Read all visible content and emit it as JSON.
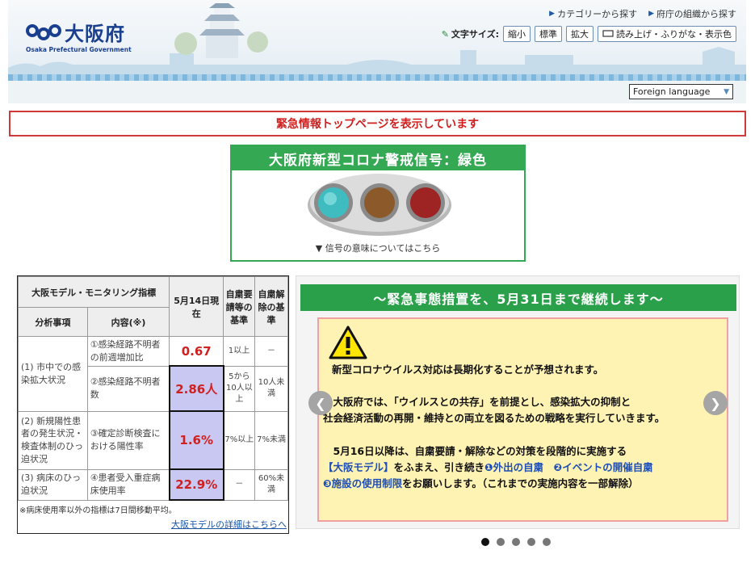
{
  "header": {
    "logo_jp": "大阪府",
    "logo_en": "Osaka Prefectural Government",
    "links": [
      "カテゴリーから探す",
      "府庁の組織から探す"
    ],
    "text_size_label": "文字サイズ:",
    "text_size_buttons": [
      "縮小",
      "標準",
      "拡大"
    ],
    "read_button": "読み上げ・ふりがな・表示色",
    "language": "Foreign language"
  },
  "emergency_banner": "緊急情報トップページを表示しています",
  "signal": {
    "title": "大阪府新型コロナ警戒信号：緑色",
    "meaning_link": "▼ 信号の意味についてはこちら",
    "colors": {
      "green": "#3fbcc0",
      "yellow": "#8c5a2a",
      "red": "#9e2424"
    }
  },
  "monitoring": {
    "head_title": "大阪モデル・モニタリング指標",
    "head_date": "5月14日現在",
    "head_request": "自粛要請等の基準",
    "head_release": "自粛解除の基準",
    "col_item": "分析事項",
    "col_content": "内容(※)",
    "rows": [
      {
        "category": "(1) 市中での感染拡大状況",
        "content": "①感染経路不明者の前週増加比",
        "value": "0.67",
        "request": "1以上",
        "release": "－"
      },
      {
        "content": "②感染経路不明者数",
        "value": "2.86人",
        "request": "5から10人以上",
        "release": "10人未満"
      },
      {
        "category": "(2) 新規陽性患者の発生状況・検査体制のひっ迫状況",
        "content": "③確定診断検査における陽性率",
        "value": "1.6%",
        "request": "7%以上",
        "release": "7%未満"
      },
      {
        "category": "(3) 病床のひっ迫状況",
        "content": "④患者受入重症病床使用率",
        "value": "22.9%",
        "request": "－",
        "release": "60%未満"
      }
    ],
    "note": "※病床使用率以外の指標は7日間移動平均。",
    "detail_link": "大阪モデルの詳細はこちらへ"
  },
  "carousel": {
    "title": "～緊急事態措置を、5月31日まで継続します～",
    "p1": "新型コロナウイルス対応は長期化することが予想されます。",
    "p2a": "　大阪府では、「ウイルスとの共存」を前提とし、感染拡大の抑制と",
    "p2b": "社会経済活動の再開・維持との両立を図るための戦略を実行していきます。",
    "p3a": "　5月16日以降は、自粛要請・解除などの対策を段階的に実施する",
    "p3b_blue": "【大阪モデル】",
    "p3b_rest": "をふまえ、引き続き",
    "p3b_item1": "❶外出の自粛",
    "p3b_item2": "❷イベントの開催自粛",
    "p3c_item3": "❸施設の使用制限",
    "p3c_rest": "をお願いします。（これまでの実施内容を一部解除）",
    "prev": "❮",
    "next": "❯",
    "dots": 5,
    "active_dot": 1
  }
}
